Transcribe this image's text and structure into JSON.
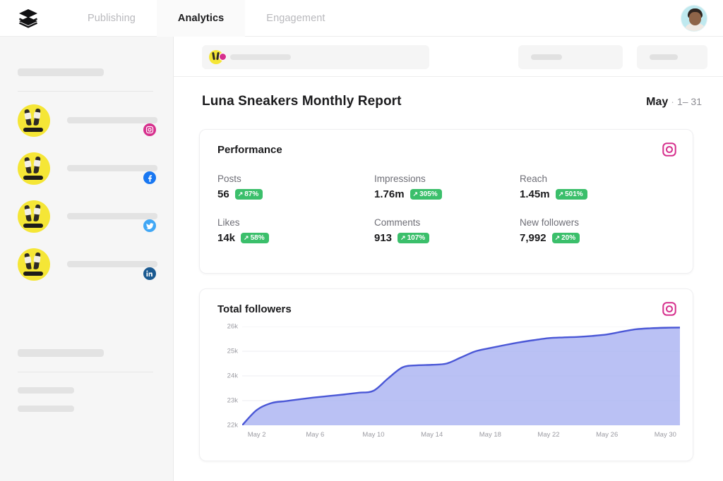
{
  "app": {
    "logo_icon": "buffer-layers-logo",
    "tabs": [
      {
        "label": "Publishing",
        "active": false
      },
      {
        "label": "Analytics",
        "active": true
      },
      {
        "label": "Engagement",
        "active": false
      }
    ],
    "avatar_name": "user-avatar"
  },
  "sidebar": {
    "accounts": [
      {
        "network": "instagram",
        "color": "#d6308d"
      },
      {
        "network": "facebook",
        "color": "#1877f2"
      },
      {
        "network": "twitter",
        "color": "#41a7f5"
      },
      {
        "network": "linkedin",
        "color": "#1b5a91"
      }
    ]
  },
  "toolbar": {
    "account_network": "instagram",
    "buttons": [
      "date-range-button",
      "export-button"
    ]
  },
  "report": {
    "title": "Luna Sneakers Monthly Report",
    "month": "May",
    "separator": "·",
    "range": "1– 31"
  },
  "performance": {
    "title": "Performance",
    "network_icon": "instagram-icon",
    "rows": [
      [
        {
          "label": "Posts",
          "value": "56",
          "delta": "87%",
          "arrow": "↗",
          "delta_color": "#3bbf6b"
        },
        {
          "label": "Impressions",
          "value": "1.76m",
          "delta": "305%",
          "arrow": "↗",
          "delta_color": "#3bbf6b"
        },
        {
          "label": "Reach",
          "value": "1.45m",
          "delta": "501%",
          "arrow": "↗",
          "delta_color": "#3bbf6b"
        }
      ],
      [
        {
          "label": "Likes",
          "value": "14k",
          "delta": "58%",
          "arrow": "↗",
          "delta_color": "#3bbf6b"
        },
        {
          "label": "Comments",
          "value": "913",
          "delta": "107%",
          "arrow": "↗",
          "delta_color": "#3bbf6b"
        },
        {
          "label": "New followers",
          "value": "7,992",
          "delta": "20%",
          "arrow": "↗",
          "delta_color": "#3bbf6b"
        }
      ]
    ]
  },
  "followers_card": {
    "title": "Total followers",
    "network_icon": "instagram-icon"
  },
  "chart_data": {
    "type": "area",
    "title": "Total followers",
    "xlabel": "",
    "ylabel": "",
    "grid": true,
    "legend": null,
    "line_color": "#4a57d6",
    "fill_color": "#aeb6f2",
    "ylim": [
      22000,
      26000
    ],
    "ytick_labels": [
      "22k",
      "23k",
      "24k",
      "25k",
      "26k"
    ],
    "yticks": [
      22000,
      23000,
      24000,
      25000,
      26000
    ],
    "xtick_labels": [
      "May 2",
      "May 6",
      "May 10",
      "May 14",
      "May 18",
      "May 22",
      "May 26",
      "May 30"
    ],
    "xticks": [
      2,
      6,
      10,
      14,
      18,
      22,
      26,
      30
    ],
    "x": [
      1,
      2,
      3,
      4,
      5,
      6,
      7,
      8,
      9,
      10,
      11,
      12,
      13,
      14,
      15,
      16,
      17,
      18,
      19,
      20,
      21,
      22,
      23,
      24,
      25,
      26,
      27,
      28,
      29,
      30,
      31
    ],
    "values": [
      22000,
      22620,
      22900,
      22980,
      23060,
      23130,
      23190,
      23250,
      23320,
      23400,
      23900,
      24350,
      24430,
      24450,
      24500,
      24750,
      25000,
      25130,
      25250,
      25360,
      25450,
      25530,
      25560,
      25580,
      25620,
      25680,
      25790,
      25890,
      25930,
      25950,
      25960
    ]
  }
}
